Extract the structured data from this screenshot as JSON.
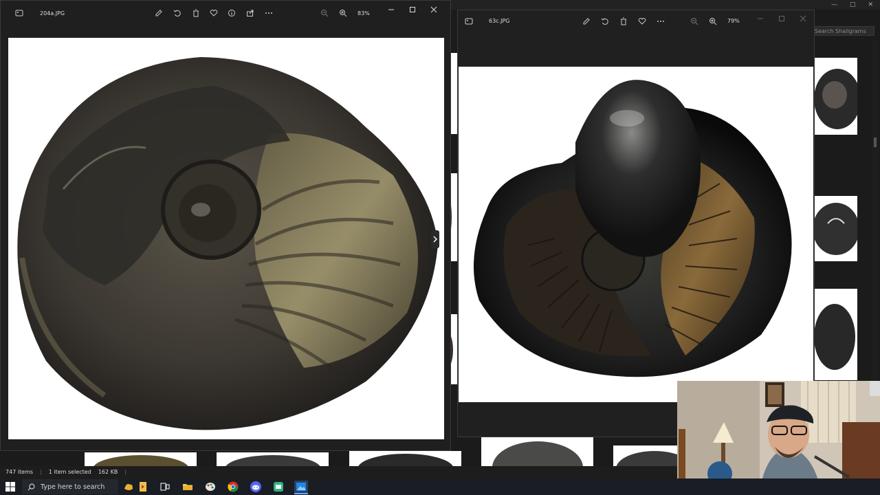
{
  "explorer": {
    "search_placeholder": "Search Shaligrams",
    "status": {
      "items": "747 items",
      "selected": "1 item selected",
      "size": "162 KB"
    }
  },
  "viewer_left": {
    "filename": "204a.JPG",
    "zoom": "83%"
  },
  "viewer_right": {
    "filename": "63c.JPG",
    "zoom": "79%"
  },
  "taskbar": {
    "search_placeholder": "Type here to search"
  },
  "colors": {
    "viewer_bg": "#202020",
    "taskbar_bg": "#1a1d24",
    "accent": "#0a64d6"
  }
}
